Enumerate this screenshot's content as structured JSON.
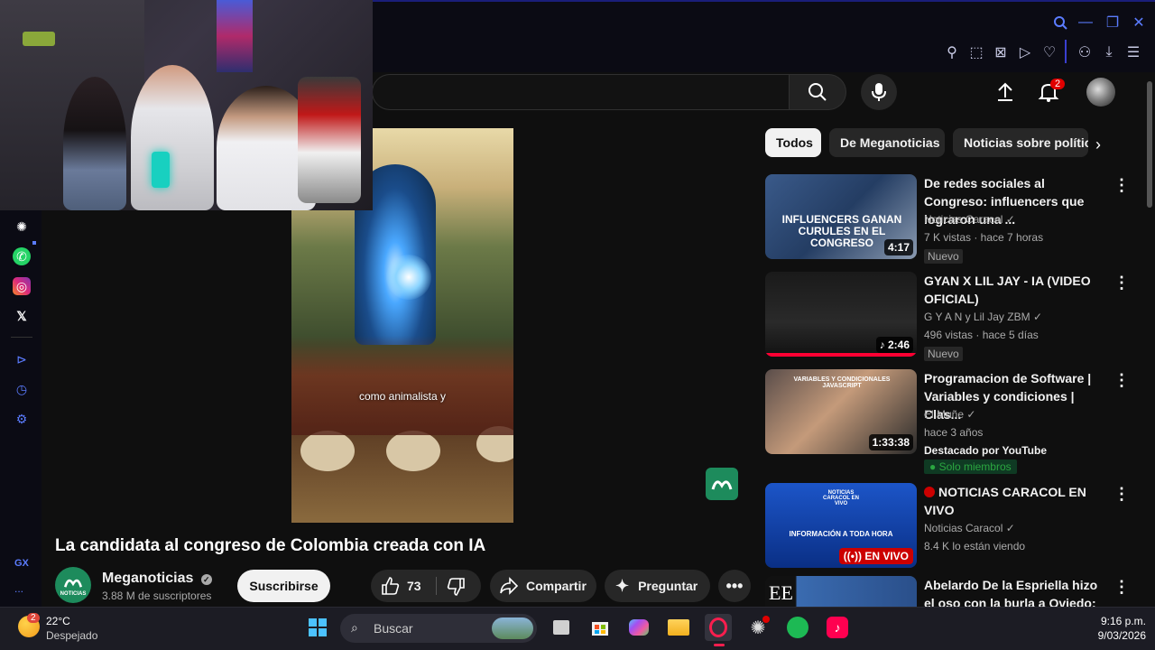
{
  "browser": {
    "icons": [
      "search-icon",
      "minimize-icon",
      "restore-icon",
      "close-icon",
      "pin-icon",
      "snapshot-icon",
      "adblock-icon",
      "player-icon",
      "heart-icon",
      "account-icon",
      "download-icon",
      "menu-icon"
    ]
  },
  "header": {
    "notifications_count": "2"
  },
  "sidebar": {
    "icons": [
      "chatgpt-icon",
      "whatsapp-icon",
      "instagram-icon",
      "x-icon",
      "player-icon",
      "history-icon",
      "settings-icon"
    ],
    "gx_label": "GX",
    "more_label": "..."
  },
  "video": {
    "caption": "como animalista y",
    "title": "La candidata al congreso de Colombia creada con IA",
    "channel": "Meganoticias",
    "subscribers": "3.88 M de suscriptores",
    "subscribe_label": "Suscribirse",
    "likes": "73",
    "share_label": "Compartir",
    "ask_label": "Preguntar",
    "avatar_label": "NOTICIAS"
  },
  "chips": [
    "Todos",
    "De Meganoticias",
    "Noticias sobre polític"
  ],
  "recommended": [
    {
      "title": "De redes sociales al Congreso: influencers que lograron una ...",
      "channel": "Noticias Caracol",
      "meta": "7 K vistas · hace 7 horas",
      "badge": "Nuevo",
      "duration": "4:17",
      "thumb_text": "INFLUENCERS GANAN CURULES EN EL CONGRESO"
    },
    {
      "title": "GYAN X LIL JAY - IA (VIDEO OFICIAL)",
      "channel": "G Y A N y Lil Jay ZBM",
      "meta": "496 vistas · hace 5 días",
      "badge": "Nuevo",
      "duration": "2:46"
    },
    {
      "title": "Programacion de Software | Variables y condiciones | Clas...",
      "channel": "El Muñe",
      "meta": "hace 3 años",
      "extra": "Destacado por YouTube",
      "members": "Solo miembros",
      "duration": "1:33:38",
      "thumb_text": "VARIABLES Y CONDICIONALES JAVASCRIPT"
    },
    {
      "title": "NOTICIAS CARACOL EN VIVO",
      "channel": "Noticias Caracol",
      "meta": "8.4 K lo están viendo",
      "live": "EN VIVO",
      "thumb_text": "INFORMACIÓN A TODA HORA",
      "thumb_logo": "NOTICIAS CARACOL EN VIVO"
    },
    {
      "title": "Abelardo De la Espriella hizo el oso con la burla a Oviedo: Leó...",
      "thumb_text": "EE"
    }
  ],
  "taskbar": {
    "weather_temp": "22°C",
    "weather_desc": "Despejado",
    "weather_badge": "2",
    "search_placeholder": "Buscar",
    "time": "9:16 p.m.",
    "date": "9/03/2026",
    "apps": [
      "windows-start-icon",
      "search",
      "task-view-icon",
      "store-icon",
      "m365-icon",
      "file-explorer-icon",
      "opera-gx-icon",
      "chatgpt-icon",
      "spotify-icon",
      "tiktok-icon"
    ]
  },
  "colors": {
    "accent_green": "#1d8b5c",
    "live_red": "#cc0000",
    "notif_red": "#e00000",
    "opera_red": "#fa1e4e"
  }
}
